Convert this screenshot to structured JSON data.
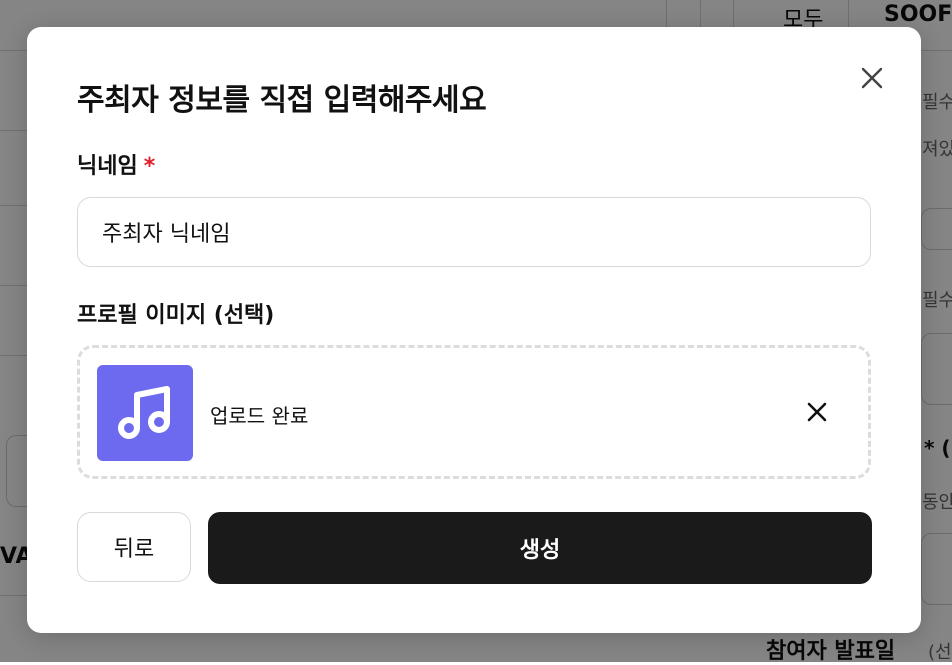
{
  "background": {
    "header_cells": [
      "모두",
      "SOOF"
    ],
    "right_fragments": [
      "필수)",
      "져있",
      "필수)",
      "* (",
      "동안",
      "참여자 발표일",
      "(선"
    ],
    "left_fragment": "VA"
  },
  "modal": {
    "title": "주최자 정보를 직접 입력해주세요",
    "nickname": {
      "label": "닉네임",
      "required_mark": "*",
      "value": "주최자 닉네임"
    },
    "profile_image": {
      "label": "프로필 이미지 (선택)",
      "status": "업로드 완료",
      "thumbnail_icon": "music-note-icon",
      "thumbnail_color": "#6d6af0"
    },
    "buttons": {
      "back": "뒤로",
      "create": "생성"
    }
  },
  "colors": {
    "required": "#e11d2b",
    "primary_button": "#1a1a1a"
  }
}
